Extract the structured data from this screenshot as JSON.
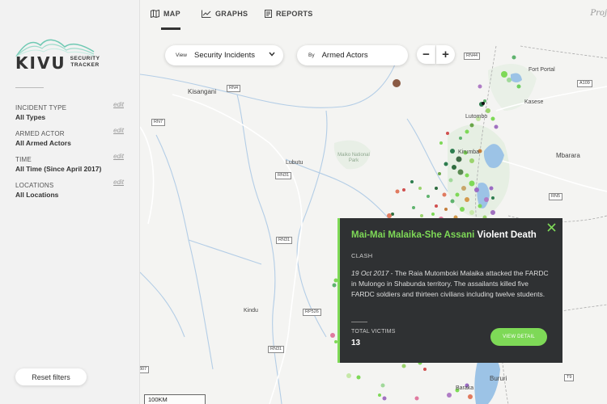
{
  "colors": {
    "accent": "#7ed957",
    "popup_bg": "#2f3133",
    "sidebar_bg": "#f2f2f2"
  },
  "logo": {
    "name": "KIVU",
    "subtitle": "SECURITY TRACKER"
  },
  "filters": [
    {
      "label": "INCIDENT TYPE",
      "value": "All Types",
      "edit": "edit"
    },
    {
      "label": "ARMED ACTOR",
      "value": "All Armed Actors",
      "edit": "edit"
    },
    {
      "label": "TIME",
      "value": "All Time (Since April 2017)",
      "edit": "edit"
    },
    {
      "label": "LOCATIONS",
      "value": "All Locations",
      "edit": "edit"
    }
  ],
  "reset_label": "Reset filters",
  "nav": {
    "items": [
      {
        "label": "MAP",
        "icon": "map-icon"
      },
      {
        "label": "GRAPHS",
        "icon": "graph-icon"
      },
      {
        "label": "REPORTS",
        "icon": "reports-icon"
      }
    ],
    "right_label": "Proj"
  },
  "map": {
    "view_prefix": "View",
    "view_value": "Security Incidents",
    "by_prefix": "By",
    "by_value": "Armed Actors",
    "zoom_out": "−",
    "zoom_in": "+",
    "scale": "100KM",
    "roads": [
      "RN4",
      "RN7",
      "RN31",
      "RN31",
      "RP526",
      "RN31",
      "RN44",
      "A109",
      "RN5",
      "T9",
      "807"
    ],
    "places": [
      "Kisangani",
      "Lubutu",
      "Kindu",
      "Fort Portal",
      "Kasese",
      "Mbarara",
      "Bururi",
      "Baraka",
      "Lutombo",
      "Kirumba"
    ],
    "park": "Maiko National Park"
  },
  "popup": {
    "actor": "Mai-Mai Malaika-She Assani",
    "incident_type": "Violent Death",
    "category": "CLASH",
    "date": "19 Oct 2017",
    "description": " - The Raia Mutomboki Malaika attacked the FARDC in Mulongo in Shabunda territory. The assailants killed five FARDC soldiers and thirteen civilians including twelve students.",
    "victims_label": "TOTAL VICTIMS",
    "victims_value": "13",
    "button": "VIEW DETAIL"
  }
}
